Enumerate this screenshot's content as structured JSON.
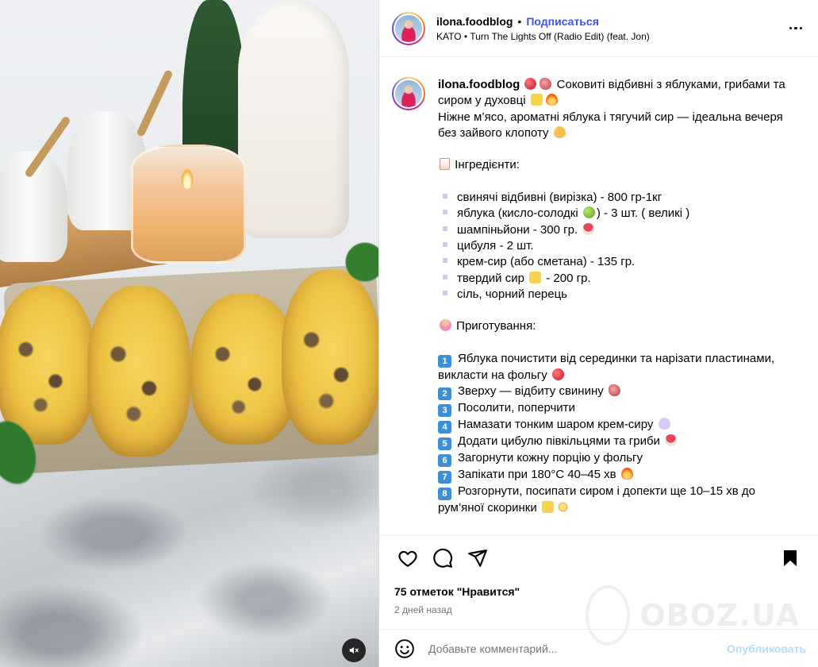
{
  "header": {
    "username": "ilona.foodblog",
    "separator": "•",
    "follow_label": "Подписаться",
    "song": "KATO • Turn The Lights Off (Radio Edit) (feat. Jon)"
  },
  "caption": {
    "username": "ilona.foodblog",
    "line1": "Соковиті відбивні з яблуками, грибами та",
    "line2": "сиром у духовці",
    "line3": "Ніжне м’ясо, ароматні яблука і тягучий сир — ідеальна вечеря",
    "line4": "без зайвого клопоту",
    "ingredients_title": "Інгредієнти:",
    "ingredients": [
      "свинячі відбивні (вирізка) - 800 гр-1кг",
      "яблука (кисло-солодкі",
      "шампіньйони - 300 гр.",
      "цибуля - 2 шт.",
      "крем-сир (або сметана) - 135 гр.",
      "твердий сир",
      "сіль, чорний перець"
    ],
    "ingredient_apple_suffix": ") - 3 шт. ( великі )",
    "ingredient_cheese_suffix": " - 200 гр.",
    "steps_title": "Приготування:",
    "steps": [
      {
        "n": "1",
        "text": "Яблука почистити від серединки та нарізати пластинами,"
      },
      {
        "n": "",
        "text": "викласти на фольгу"
      },
      {
        "n": "2",
        "text": "Зверху — відбиту свинину"
      },
      {
        "n": "3",
        "text": "Посолити, поперчити"
      },
      {
        "n": "4",
        "text": "Намазати тонким шаром крем-сиру"
      },
      {
        "n": "5",
        "text": "Додати цибулю півкільцями та гриби"
      },
      {
        "n": "6",
        "text": "Загорнути кожну порцію у фольгу"
      },
      {
        "n": "7",
        "text": "Запікати при 180°C 40–45 хв"
      },
      {
        "n": "8",
        "text": "Розгорнути, посипати сиром і допекти ще 10–15 хв до"
      },
      {
        "n": "",
        "text": "рум’яної скоринки"
      }
    ]
  },
  "icons": {
    "like": "heart-icon",
    "comment": "comment-icon",
    "share": "share-icon",
    "save": "bookmark-icon",
    "more": "more-icon",
    "emoji": "smile-icon",
    "mute": "speaker-muted-icon"
  },
  "stats": {
    "likes": "75 отметок \"Нравится\"",
    "time": "2 дней назад"
  },
  "comment_box": {
    "placeholder": "Добавьте комментарий...",
    "publish_label": "Опубликовать"
  },
  "watermark": "OBOZ.UA",
  "colors": {
    "follow": "#4150f7",
    "publish": "#b3dbff",
    "muted_text": "#737373"
  }
}
